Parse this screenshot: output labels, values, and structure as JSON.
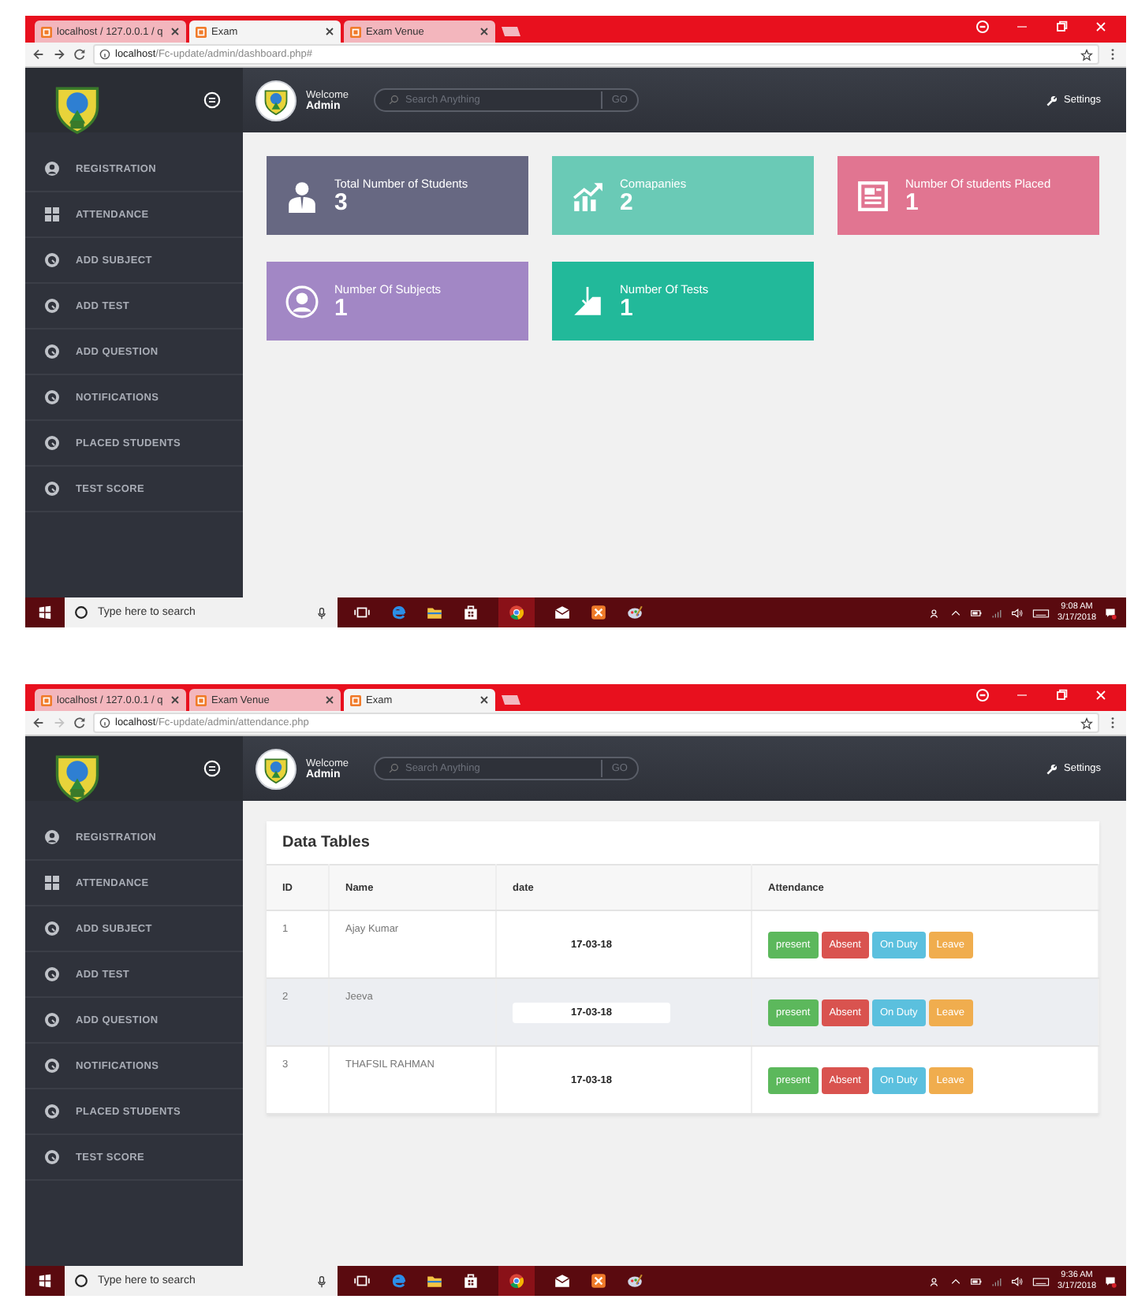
{
  "screens": [
    {
      "tabs": [
        {
          "label": "localhost / 127.0.0.1 / q",
          "selected": false
        },
        {
          "label": "Exam",
          "selected": true
        },
        {
          "label": "Exam Venue",
          "selected": false
        }
      ],
      "forward_disabled": false,
      "url_host": "localhost",
      "url_path": "/Fc-update/admin/dashboard.php#",
      "header": {
        "welcome": "Welcome",
        "user": "Admin",
        "search_placeholder": "Search Anything",
        "search_button": "GO",
        "settings": "Settings"
      },
      "sidebar": [
        {
          "label": "REGISTRATION",
          "kind": "person"
        },
        {
          "label": "ATTENDANCE",
          "kind": "grid"
        },
        {
          "label": "ADD SUBJECT",
          "kind": "gauge"
        },
        {
          "label": "ADD TEST",
          "kind": "gauge"
        },
        {
          "label": "ADD QUESTION",
          "kind": "gauge"
        },
        {
          "label": "NOTIFICATIONS",
          "kind": "gauge"
        },
        {
          "label": "PLACED STUDENTS",
          "kind": "gauge"
        },
        {
          "label": "TEST SCORE",
          "kind": "gauge"
        }
      ],
      "content": {
        "kind": "dashboard",
        "cards": [
          {
            "label": "Total Number of Students",
            "value": "3",
            "color": "#676882",
            "kind": "user"
          },
          {
            "label": "Comapanies",
            "value": "2",
            "color": "#6acab6",
            "kind": "chart"
          },
          {
            "label": "Number Of students Placed",
            "value": "1",
            "color": "#e17591",
            "kind": "document"
          },
          {
            "label": "Number Of Subjects",
            "value": "1",
            "color": "#a287c5",
            "kind": "person"
          },
          {
            "label": "Number Of Tests",
            "value": "1",
            "color": "#22b99a",
            "kind": "download"
          }
        ]
      },
      "taskbar": {
        "search_placeholder": "Type here to search",
        "time": "9:08 AM",
        "date": "3/17/2018"
      }
    },
    {
      "tabs": [
        {
          "label": "localhost / 127.0.0.1 / q",
          "selected": false
        },
        {
          "label": "Exam Venue",
          "selected": false
        },
        {
          "label": "Exam",
          "selected": true
        }
      ],
      "forward_disabled": true,
      "url_host": "localhost",
      "url_path": "/Fc-update/admin/attendance.php",
      "header": {
        "welcome": "Welcome",
        "user": "Admin",
        "search_placeholder": "Search Anything",
        "search_button": "GO",
        "settings": "Settings"
      },
      "sidebar": [
        {
          "label": "REGISTRATION",
          "kind": "person"
        },
        {
          "label": "ATTENDANCE",
          "kind": "grid"
        },
        {
          "label": "ADD SUBJECT",
          "kind": "gauge"
        },
        {
          "label": "ADD TEST",
          "kind": "gauge"
        },
        {
          "label": "ADD QUESTION",
          "kind": "gauge"
        },
        {
          "label": "NOTIFICATIONS",
          "kind": "gauge"
        },
        {
          "label": "PLACED STUDENTS",
          "kind": "gauge"
        },
        {
          "label": "TEST SCORE",
          "kind": "gauge"
        }
      ],
      "content": {
        "kind": "table",
        "title": "Data Tables",
        "columns": [
          "ID",
          "Name",
          "date",
          "Attendance"
        ],
        "rows": [
          {
            "id": "1",
            "name": "Ajay Kumar",
            "date": "17-03-18",
            "hovered": false,
            "buttons": [
              {
                "label": "present",
                "kind": "success"
              },
              {
                "label": "Absent",
                "kind": "danger"
              },
              {
                "label": "On Duty",
                "kind": "info"
              },
              {
                "label": "Leave",
                "kind": "warning"
              }
            ]
          },
          {
            "id": "2",
            "name": "Jeeva",
            "date": "17-03-18",
            "hovered": true,
            "buttons": [
              {
                "label": "present",
                "kind": "success"
              },
              {
                "label": "Absent",
                "kind": "danger"
              },
              {
                "label": "On Duty",
                "kind": "info"
              },
              {
                "label": "Leave",
                "kind": "warning"
              }
            ]
          },
          {
            "id": "3",
            "name": "THAFSIL RAHMAN",
            "date": "17-03-18",
            "hovered": false,
            "buttons": [
              {
                "label": "present",
                "kind": "success"
              },
              {
                "label": "Absent",
                "kind": "danger"
              },
              {
                "label": "On Duty",
                "kind": "info"
              },
              {
                "label": "Leave",
                "kind": "warning"
              }
            ]
          }
        ]
      },
      "taskbar": {
        "search_placeholder": "Type here to search",
        "time": "9:36 AM",
        "date": "3/17/2018"
      }
    }
  ]
}
